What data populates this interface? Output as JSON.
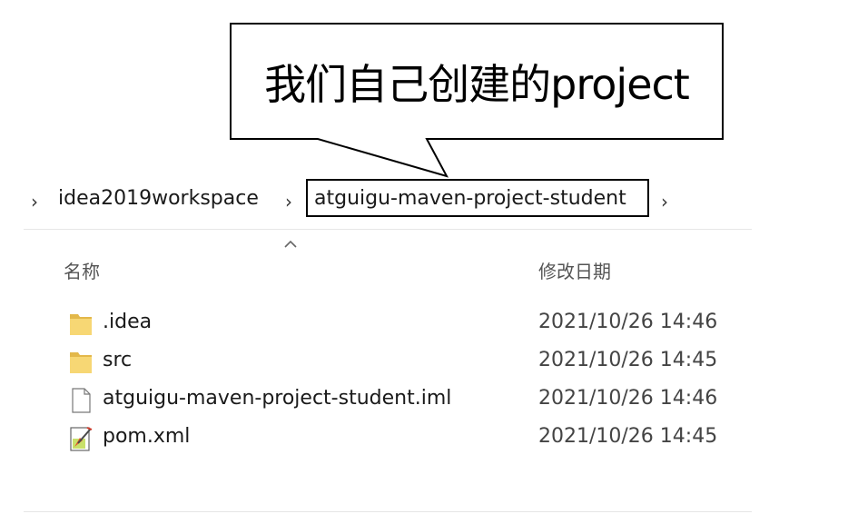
{
  "callout": {
    "text": "我们自己创建的project"
  },
  "breadcrumb": {
    "items": [
      "idea2019workspace",
      "atguigu-maven-project-student"
    ],
    "separator": "›"
  },
  "columns": {
    "name": "名称",
    "modified": "修改日期"
  },
  "files": [
    {
      "name": ".idea",
      "modified": "2021/10/26 14:46",
      "icon": "folder-icon"
    },
    {
      "name": "src",
      "modified": "2021/10/26 14:45",
      "icon": "folder-icon"
    },
    {
      "name": "atguigu-maven-project-student.iml",
      "modified": "2021/10/26 14:46",
      "icon": "file-icon"
    },
    {
      "name": "pom.xml",
      "modified": "2021/10/26 14:45",
      "icon": "xml-file-icon"
    }
  ],
  "colors": {
    "folder": "#f7d774",
    "folder_dark": "#e3b84a",
    "divider": "#e6e6e6"
  }
}
